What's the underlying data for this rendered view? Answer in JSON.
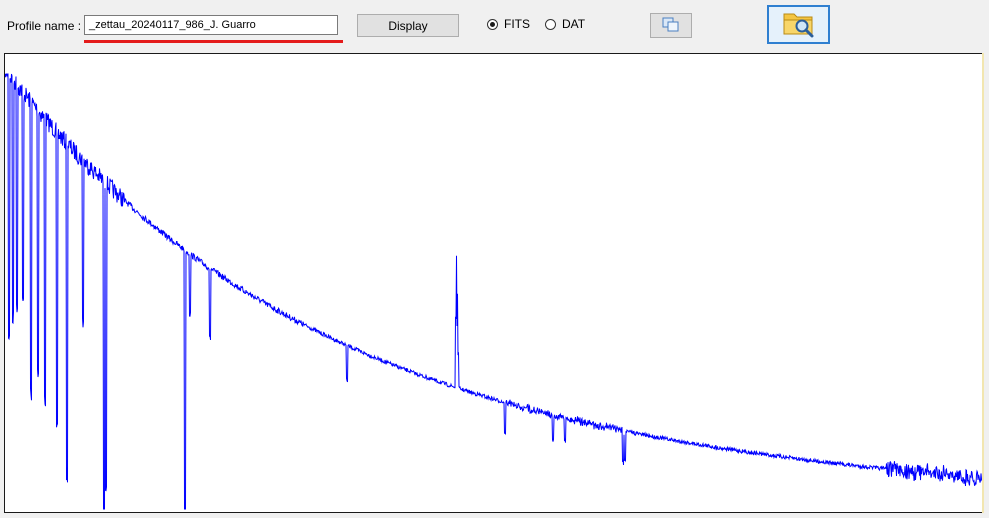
{
  "toolbar": {
    "profile_label": "Profile name :",
    "profile_value": "_zettau_20240117_986_J. Guarro",
    "display_label": "Display",
    "format_options": [
      {
        "label": "FITS",
        "selected": true
      },
      {
        "label": "DAT",
        "selected": false
      }
    ],
    "copy_icon": "copy-icon",
    "open_icon": "folder-search-icon",
    "accent_color": "#2f7fd0",
    "underline_color": "#e41b1b"
  },
  "spectrum": {
    "line_color": "#0000ff",
    "background": "#ffffff"
  }
}
